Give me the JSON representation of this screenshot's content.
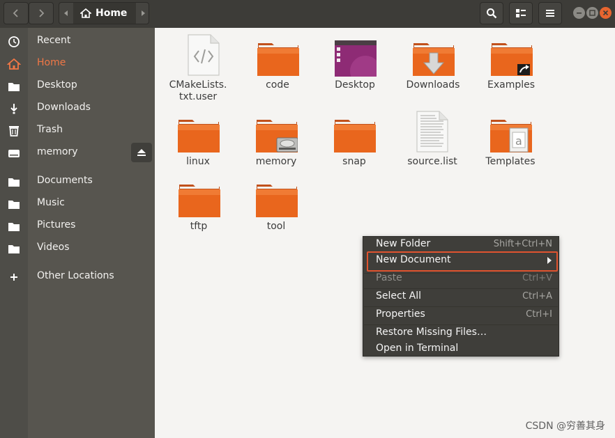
{
  "header": {
    "location_label": "Home",
    "icons": [
      "back-icon",
      "forward-icon",
      "path-left-icon",
      "home-icon",
      "path-right-icon",
      "search-icon",
      "view-toggle-icon",
      "menu-icon",
      "minimize-icon",
      "maximize-icon",
      "close-icon"
    ]
  },
  "sidebar": {
    "items": [
      {
        "label": "Recent",
        "icon": "clock-icon"
      },
      {
        "label": "Home",
        "icon": "home-icon",
        "active": true
      },
      {
        "label": "Desktop",
        "icon": "folder-icon"
      },
      {
        "label": "Downloads",
        "icon": "download-icon"
      },
      {
        "label": "Trash",
        "icon": "trash-icon"
      },
      {
        "label": "memory",
        "icon": "drive-icon"
      },
      {
        "label": "Documents",
        "icon": "folder-icon"
      },
      {
        "label": "Music",
        "icon": "folder-icon"
      },
      {
        "label": "Pictures",
        "icon": "folder-icon"
      },
      {
        "label": "Videos",
        "icon": "folder-icon"
      },
      {
        "label": "Other Locations",
        "icon": "plus-icon"
      }
    ],
    "accent": "#f07746"
  },
  "files": {
    "items": [
      {
        "label1": "CMakeLists.",
        "label2": "txt.user",
        "type": "code-file"
      },
      {
        "label1": "code",
        "type": "folder"
      },
      {
        "label1": "Desktop",
        "type": "desktop-folder"
      },
      {
        "label1": "Downloads",
        "type": "downloads-folder"
      },
      {
        "label1": "Examples",
        "type": "link-folder"
      },
      {
        "label1": "linux",
        "type": "folder"
      },
      {
        "label1": "memory",
        "type": "drive-folder"
      },
      {
        "label1": "snap",
        "type": "folder"
      },
      {
        "label1": "source.list",
        "type": "text-file"
      },
      {
        "label1": "Templates",
        "type": "templates-folder"
      },
      {
        "label1": "tftp",
        "type": "folder"
      },
      {
        "label1": "tool",
        "type": "folder"
      }
    ],
    "folder_color": "#e9661d"
  },
  "context_menu": {
    "items": [
      {
        "label": "New Folder",
        "shortcut": "Shift+Ctrl+N"
      },
      {
        "label": "New Document",
        "shortcut": "",
        "submenu": true,
        "highlighted": true
      },
      {
        "label": "Paste",
        "shortcut": "Ctrl+V",
        "disabled": true
      },
      {
        "label": "Select All",
        "shortcut": "Ctrl+A"
      },
      {
        "label": "Properties",
        "shortcut": "Ctrl+I"
      },
      {
        "label": "Restore Missing Files…",
        "shortcut": ""
      },
      {
        "label": "Open in Terminal",
        "shortcut": ""
      }
    ],
    "highlight_color": "#e0532f"
  },
  "watermark": "CSDN @穷善其身"
}
